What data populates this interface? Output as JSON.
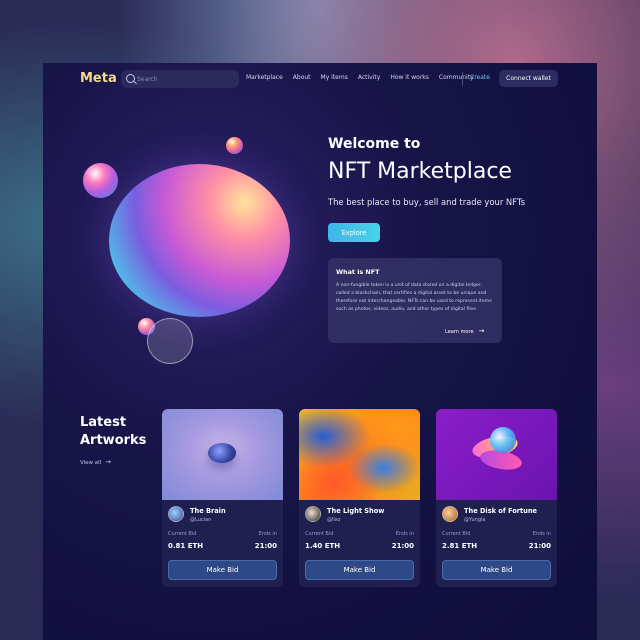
{
  "nav": {
    "logo": "Meta",
    "search_placeholder": "Search",
    "links": [
      "Marketplace",
      "About",
      "My items",
      "Activity",
      "How it works",
      "Community"
    ],
    "create": "Create",
    "connect_wallet": "Connect wallet"
  },
  "hero": {
    "welcome": "Welcome to",
    "title": "NFT Marketplace",
    "subtitle": "The best place to buy, sell and trade your NFTs",
    "explore": "Explore"
  },
  "what_is_nft": {
    "title": "What is NFT",
    "body": "A non-fungible token is a unit of data stored on a digital ledger, called a blockchain, that certifies a digital asset to be unique and therefore not interchangeable. NFTs can be used to represent items such as photos, videos, audio, and other types of digital files.",
    "learn_more": "Learn more"
  },
  "latest": {
    "title": "Latest Artworks",
    "view_all": "View all",
    "cards": [
      {
        "name": "The Brain",
        "user": "@Lucian",
        "bid_label": "Current Bid",
        "bid": "0.81 ETH",
        "ends_label": "Ends in",
        "ends": "21:00",
        "button": "Make Bid"
      },
      {
        "name": "The Light Show",
        "user": "@liso",
        "bid_label": "Current Bid",
        "bid": "1.40 ETH",
        "ends_label": "Ends in",
        "ends": "21:00",
        "button": "Make Bid"
      },
      {
        "name": "The Disk of Fortune",
        "user": "@Yungla",
        "bid_label": "Current Bid",
        "bid": "2.81 ETH",
        "ends_label": "Ends in",
        "ends": "21:00",
        "button": "Make Bid"
      }
    ]
  },
  "colors": {
    "accent": "#4ac3ea",
    "logo": "#f3d98a",
    "panel": "#0f0d3a",
    "button": "#2d4a86"
  },
  "icons": [
    "search-icon",
    "arrow-right-icon"
  ]
}
